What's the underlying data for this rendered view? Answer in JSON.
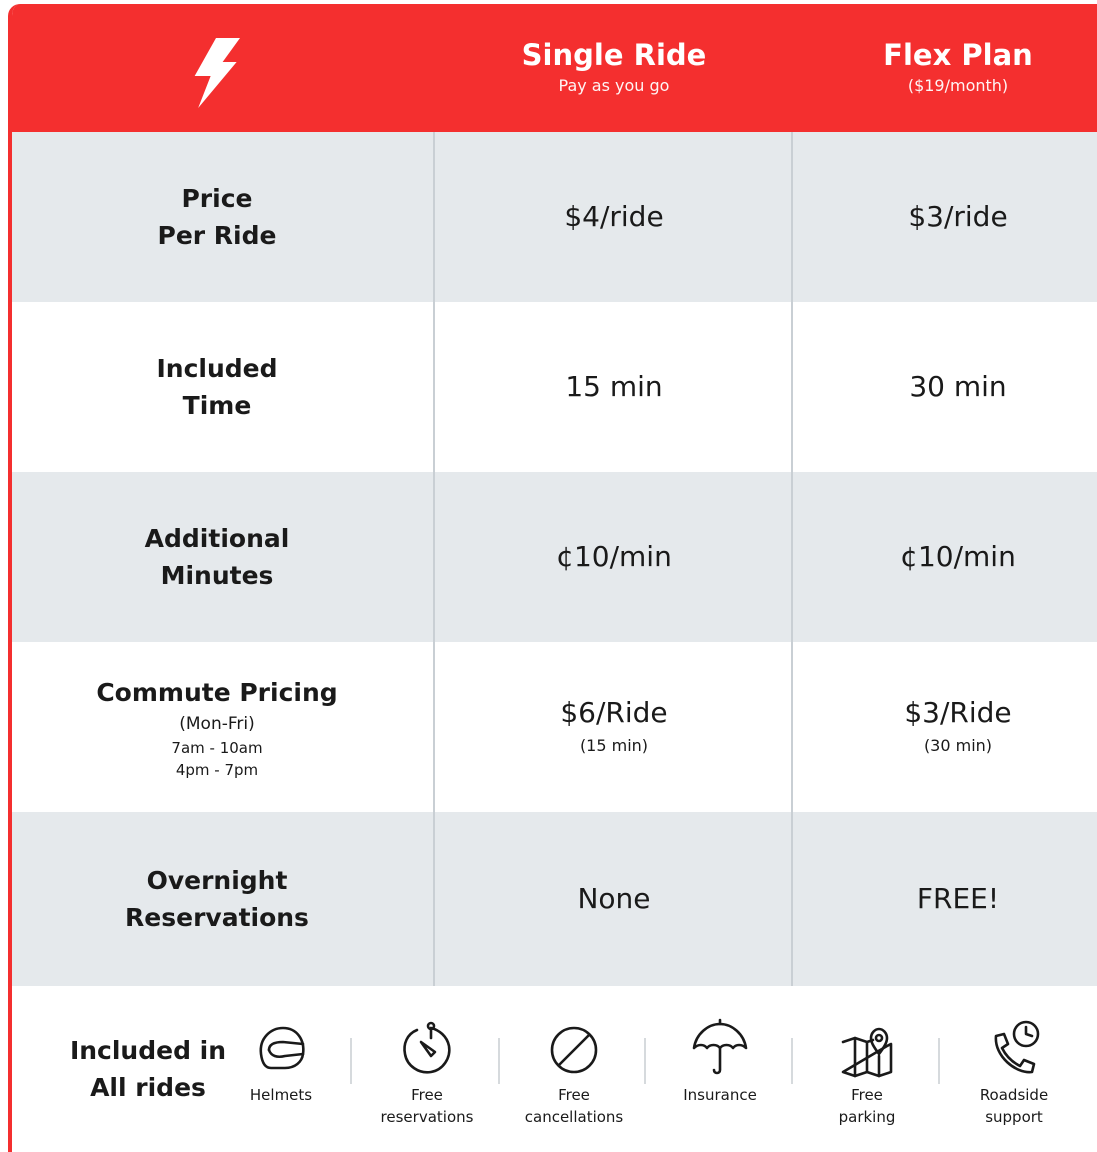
{
  "colors": {
    "brand_red": "#f42f2f",
    "shade_row": "#e5e9ec",
    "divider": "#c9cfd4"
  },
  "header": {
    "logo_icon": "lightning-bolt-icon",
    "plans": [
      {
        "name": "Single Ride",
        "subtitle": "Pay as you go"
      },
      {
        "name": "Flex Plan",
        "subtitle": "($19/month)"
      }
    ]
  },
  "rows": [
    {
      "label": "Price\nPer Ride",
      "single": "$4/ride",
      "flex": "$3/ride"
    },
    {
      "label": "Included\nTime",
      "single": "15 min",
      "flex": "30 min"
    },
    {
      "label": "Additional\nMinutes",
      "single": "¢10/min",
      "flex": "¢10/min"
    },
    {
      "label": "Commute Pricing",
      "label_days": "(Mon-Fri)",
      "label_hours": "7am - 10am\n4pm - 7pm",
      "single": "$6/Ride",
      "single_note": "(15 min)",
      "flex": "$3/Ride",
      "flex_note": "(30 min)"
    },
    {
      "label": "Overnight\nReservations",
      "single": "None",
      "flex": "FREE!"
    }
  ],
  "footer": {
    "title": "Included in\nAll rides",
    "features": [
      {
        "icon": "helmet-icon",
        "label": "Helmets"
      },
      {
        "icon": "stopwatch-icon",
        "label": "Free\nreservations"
      },
      {
        "icon": "cancel-icon",
        "label": "Free\ncancellations"
      },
      {
        "icon": "umbrella-icon",
        "label": "Insurance"
      },
      {
        "icon": "map-pin-icon",
        "label": "Free\nparking"
      },
      {
        "icon": "phone-clock-icon",
        "label": "Roadside\nsupport"
      }
    ]
  }
}
